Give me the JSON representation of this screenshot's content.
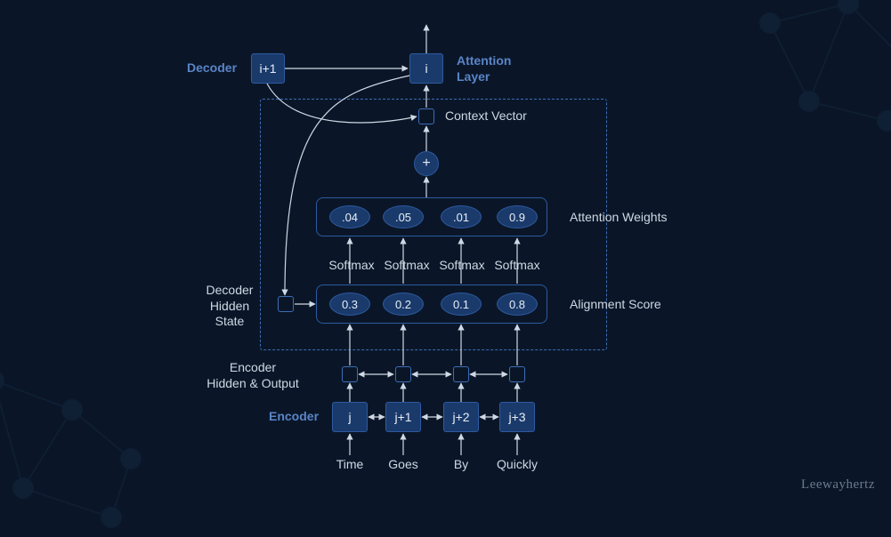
{
  "labels": {
    "decoder": "Decoder",
    "attention_layer": "Attention Layer",
    "context_vector": "Context Vector",
    "attention_weights": "Attention Weights",
    "alignment_score": "Alignment Score",
    "decoder_hidden_state": "Decoder\nHidden\nState",
    "encoder_hidden_output": "Encoder\nHidden & Output",
    "encoder": "Encoder",
    "softmax": "Softmax",
    "plus": "+"
  },
  "decoder_nodes": {
    "prev": "i+1",
    "current": "i"
  },
  "attention_weights": [
    ".04",
    ".05",
    ".01",
    "0.9"
  ],
  "alignment_scores": [
    "0.3",
    "0.2",
    "0.1",
    "0.8"
  ],
  "encoder_nodes": [
    "j",
    "j+1",
    "j+2",
    "j+3"
  ],
  "input_tokens": [
    "Time",
    "Goes",
    "By",
    "Quickly"
  ],
  "brand": "Leewayhertz",
  "colors": {
    "bg": "#0a1628",
    "box": "#1a3a6b",
    "border": "#2d5aa0",
    "accent": "#5a84c7"
  }
}
